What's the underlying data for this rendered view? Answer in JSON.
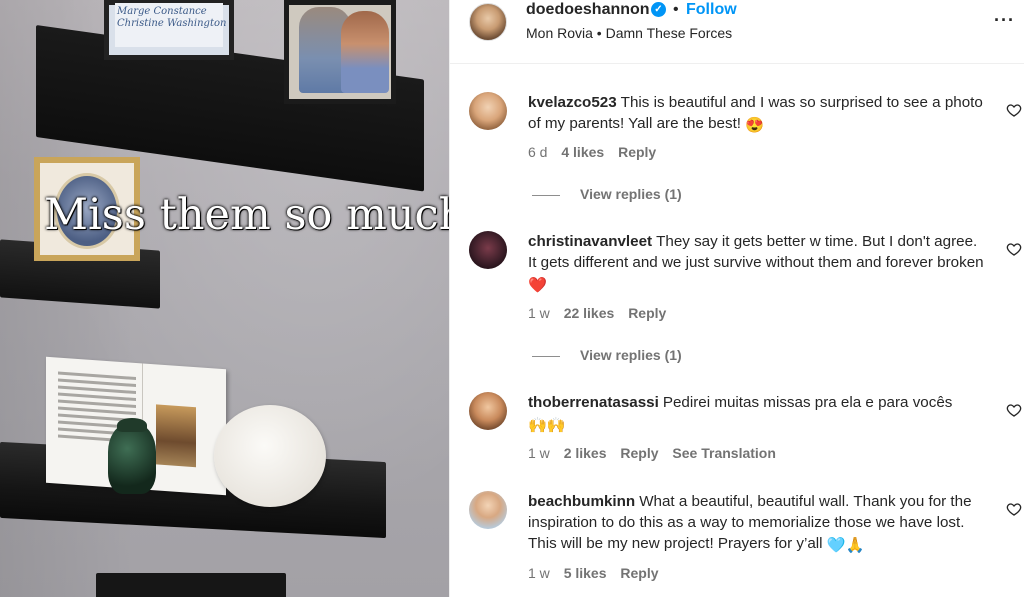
{
  "media": {
    "overlay_text": "Miss them so much",
    "frame_text_1": "Marge Constance",
    "frame_text_2": "Christine Washington"
  },
  "post": {
    "username": "doedoeshannon",
    "verified_icon": "verified-badge-icon",
    "separator": "•",
    "follow_label": "Follow",
    "subline": "Mon Rovia • Damn These Forces",
    "more_label": "···"
  },
  "comments": [
    {
      "username": "kvelazco523",
      "text": "This is beautiful and I was so surprised to see a photo of my parents! Yall are the best!",
      "emoji": "😍",
      "time": "6 d",
      "likes": "4 likes",
      "reply": "Reply",
      "view_replies": "View replies (1)"
    },
    {
      "username": "christinavanvleet",
      "text": "They say it gets better w time. But I don't agree. It gets different and we just survive without them and forever broken",
      "emoji": "❤️",
      "time": "1 w",
      "likes": "22 likes",
      "reply": "Reply",
      "view_replies": "View replies (1)"
    },
    {
      "username": "thoberrenatasassi",
      "text": "Pedirei muitas missas pra ela e para vocês",
      "emoji": "🙌🙌",
      "time": "1 w",
      "likes": "2 likes",
      "reply": "Reply",
      "translation": "See Translation"
    },
    {
      "username": "beachbumkinn",
      "text": "What a beautiful, beautiful wall. Thank you for the inspiration to do this as a way to memorialize those we have lost. This will be my new project! Prayers for y’all",
      "emoji": "🩵🙏",
      "time": "1 w",
      "likes": "5 likes",
      "reply": "Reply"
    }
  ],
  "colors": {
    "link_blue": "#0095f6",
    "text_primary": "#262626",
    "text_secondary": "#737373"
  }
}
